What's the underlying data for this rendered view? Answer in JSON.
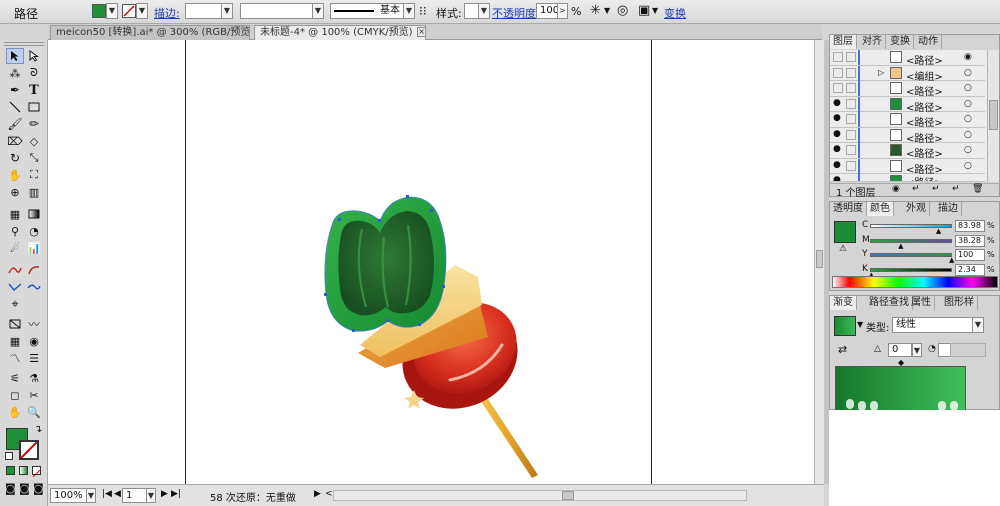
{
  "control_bar": {
    "object_type": "路径",
    "stroke_label": "描边:",
    "stroke_weight_value": "",
    "profile_label": "基本",
    "style_label": "样式:",
    "opacity_label": "不透明度:",
    "opacity_value": "100",
    "opacity_unit": "%",
    "transform_label": "变换",
    "fill_color": "#1f8f3a"
  },
  "tabs": [
    {
      "label": "meicon50 [转换].ai* @ 300% (RGB/预览)",
      "active": false
    },
    {
      "label": "未标题-4* @ 100% (CMYK/预览)",
      "active": true
    }
  ],
  "status_bar": {
    "zoom": "100%",
    "page": "1",
    "undo_text": "58 次还原：无重做"
  },
  "layers_panel": {
    "tabs": [
      "图层",
      "对齐",
      "变换",
      "动作"
    ],
    "rows": [
      {
        "name": "<路径>",
        "visible": false
      },
      {
        "name": "<编组>",
        "visible": false
      },
      {
        "name": "<路径>",
        "visible": false
      },
      {
        "name": "<路径>",
        "visible": true
      },
      {
        "name": "<路径>",
        "visible": true
      },
      {
        "name": "<路径>",
        "visible": true
      },
      {
        "name": "<路径>",
        "visible": true
      },
      {
        "name": "<路径>",
        "visible": true
      },
      {
        "name": "<路径>",
        "visible": true
      }
    ],
    "count_label": "1 个图层"
  },
  "color_panel": {
    "tabs": [
      "透明度",
      "颜色",
      "外观",
      "描边"
    ],
    "fill_color": "#1e8b38",
    "channels": [
      {
        "label": "C",
        "value": "83.98",
        "fraction": 0.84
      },
      {
        "label": "M",
        "value": "38.28",
        "fraction": 0.38
      },
      {
        "label": "Y",
        "value": "100",
        "fraction": 1.0
      },
      {
        "label": "K",
        "value": "2.34",
        "fraction": 0.02
      }
    ]
  },
  "gradient_panel": {
    "tabs": [
      "渐变",
      "路径查找",
      "属性",
      "图形样"
    ],
    "type_label": "类型:",
    "type_value": "线性",
    "angle_value": "0"
  }
}
